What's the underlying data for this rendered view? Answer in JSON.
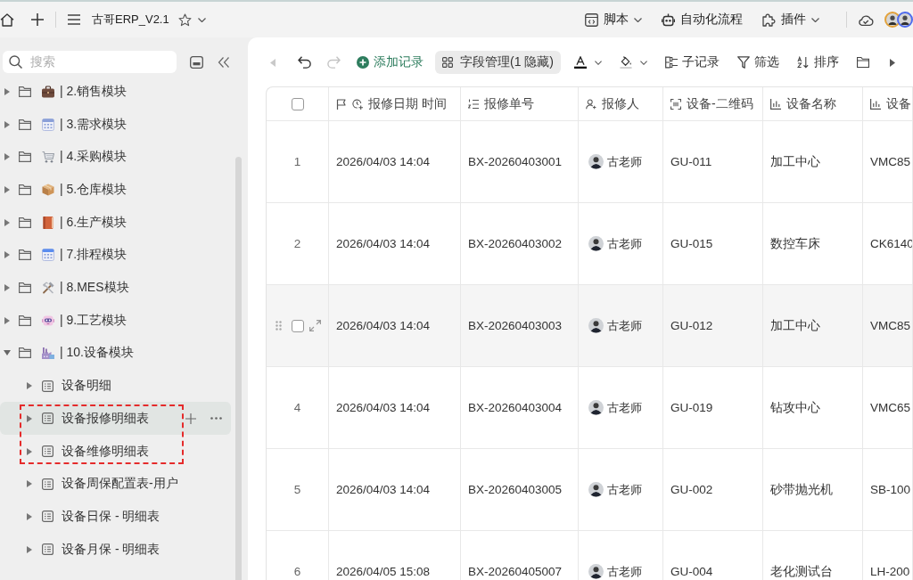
{
  "top_bar": {
    "title": "古哥ERP_V2.1",
    "actions": [
      {
        "kind": "script",
        "label": "脚本",
        "dropdown": true
      },
      {
        "kind": "automation",
        "label": "自动化流程",
        "dropdown": false
      },
      {
        "kind": "plugin",
        "label": "插件",
        "dropdown": true
      }
    ],
    "collaborators": [
      {
        "color": "#e3a23a"
      },
      {
        "color": "#4f6bed"
      }
    ]
  },
  "sidebar": {
    "search": {
      "placeholder": "搜索"
    },
    "tree": [
      {
        "label": "| 2.销售模块",
        "expanded": false,
        "selected": false
      },
      {
        "label": "| 3.需求模块",
        "expanded": false,
        "selected": false
      },
      {
        "label": "| 4.采购模块",
        "expanded": false,
        "selected": false
      },
      {
        "label": "| 5.仓库模块",
        "expanded": false,
        "selected": false
      },
      {
        "label": "| 6.生产模块",
        "expanded": false,
        "selected": false
      },
      {
        "label": "| 7.排程模块",
        "expanded": false,
        "selected": false
      },
      {
        "label": "| 8.MES模块",
        "expanded": false,
        "selected": false
      },
      {
        "label": "| 9.工艺模块",
        "expanded": false,
        "selected": false
      },
      {
        "label": "| 10.设备模块",
        "expanded": true,
        "selected": false,
        "children": [
          {
            "label": "设备明细",
            "expanded": false,
            "selected": false,
            "annotated": false
          },
          {
            "label": "设备报修明细表",
            "expanded": false,
            "selected": true,
            "annotated": true
          },
          {
            "label": "设备维修明细表",
            "expanded": false,
            "selected": false,
            "annotated": true
          },
          {
            "label": "设备周保配置表-用户",
            "expanded": false,
            "selected": false,
            "annotated": false
          },
          {
            "label": "设备日保 - 明细表",
            "expanded": false,
            "selected": false,
            "annotated": false
          },
          {
            "label": "设备月保 - 明细表",
            "expanded": false,
            "selected": false,
            "annotated": false
          }
        ]
      }
    ]
  },
  "toolbar": {
    "scroll_left": {
      "disabled": true
    },
    "undo": {
      "disabled": false
    },
    "redo": {
      "disabled": true
    },
    "items": [
      {
        "kind": "add",
        "label": "添加记录",
        "active": false,
        "dropdown": false
      },
      {
        "kind": "fields",
        "label": "字段管理(1 隐藏)",
        "active": true,
        "dropdown": false
      },
      {
        "kind": "text_color",
        "active": false,
        "dropdown": true
      },
      {
        "kind": "fill_color",
        "active": false,
        "dropdown": true
      },
      {
        "kind": "subrecord",
        "label": "子记录",
        "active": false,
        "dropdown": false
      },
      {
        "kind": "filter",
        "label": "筛选",
        "active": false,
        "dropdown": false
      },
      {
        "kind": "sort",
        "label": "排序",
        "active": false,
        "dropdown": false
      },
      {
        "kind": "group",
        "active": false,
        "dropdown": false
      }
    ],
    "scroll_right": {
      "disabled": false
    }
  },
  "table": {
    "select_all": {
      "checked": false
    },
    "columns": [
      {
        "kind": "datetime",
        "label": "报修日期 时间",
        "primary": true
      },
      {
        "kind": "autonumber",
        "label": "报修单号",
        "primary": false
      },
      {
        "kind": "user",
        "label": "报修人",
        "primary": false
      },
      {
        "kind": "barcode",
        "label": "设备-二维码",
        "primary": false
      },
      {
        "kind": "lookup",
        "label": "设备名称",
        "primary": false
      },
      {
        "kind": "lookup",
        "label": "设备",
        "primary": false
      }
    ],
    "rows": [
      {
        "number": "1",
        "hovered": false,
        "checked": false,
        "cells": [
          "2026/04/03 14:04",
          "BX-20260403001",
          "古老师",
          "GU-011",
          "加工中心",
          "VMC85"
        ]
      },
      {
        "number": "2",
        "hovered": false,
        "checked": false,
        "cells": [
          "2026/04/03 14:04",
          "BX-20260403002",
          "古老师",
          "GU-015",
          "数控车床",
          "CK6140"
        ]
      },
      {
        "hovered": true,
        "checked": false,
        "cells": [
          "2026/04/03 14:04",
          "BX-20260403003",
          "古老师",
          "GU-012",
          "加工中心",
          "VMC85"
        ]
      },
      {
        "number": "4",
        "hovered": false,
        "checked": false,
        "cells": [
          "2026/04/03 14:04",
          "BX-20260403004",
          "古老师",
          "GU-019",
          "钻攻中心",
          "VMC65"
        ]
      },
      {
        "number": "5",
        "hovered": false,
        "checked": false,
        "cells": [
          "2026/04/03 14:04",
          "BX-20260403005",
          "古老师",
          "GU-002",
          "砂带抛光机",
          "SB-100"
        ]
      },
      {
        "number": "6",
        "hovered": false,
        "checked": false,
        "cells": [
          "2026/04/05 15:08",
          "BX-20260405007",
          "古老师",
          "GU-004",
          "老化测试台",
          "LH-200"
        ]
      }
    ]
  }
}
